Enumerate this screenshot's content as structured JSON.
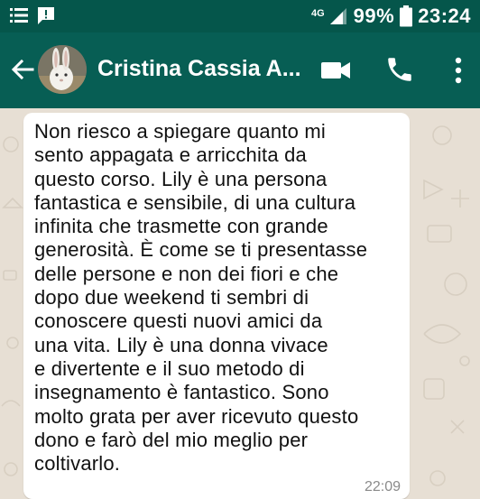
{
  "status_bar": {
    "network_type": "4G",
    "battery_percent": "99%",
    "time": "23:24",
    "icons": [
      "menu-lines-icon",
      "message-notification-icon",
      "signal-icon",
      "battery-icon"
    ]
  },
  "app_bar": {
    "contact_name": "Cristina Cassia A...",
    "icons": [
      "back-arrow-icon",
      "video-call-icon",
      "phone-icon",
      "more-vert-icon"
    ],
    "colors": {
      "status_bar": "#05564b",
      "app_bar": "#075e54"
    }
  },
  "message": {
    "text": "Non riesco a spiegare quanto mi\nsento appagata e arricchita da\nquesto corso. Lily è una persona\nfantastica e sensibile, di una cultura\ninfinita che trasmette con grande\ngenerosità. È come se ti presentasse\ndelle persone e non dei fiori e che\ndopo due weekend ti sembri di\nconoscere questi nuovi amici da\nuna vita.  Lily è una donna vivace\ne divertente e il suo metodo di\ninsegnamento è fantastico. Sono\nmolto grata per aver ricevuto questo\ndono e farò del mio meglio per\ncoltivarlo.",
    "time": "22:09"
  }
}
